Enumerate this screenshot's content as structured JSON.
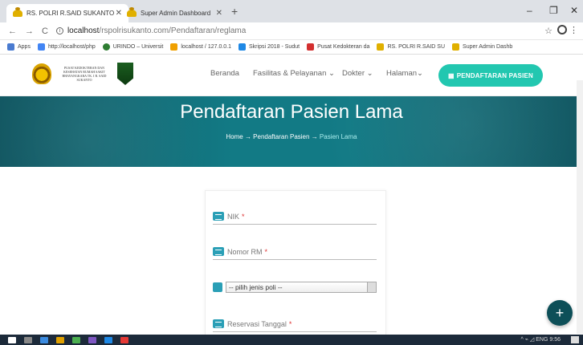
{
  "browser": {
    "tabs": [
      {
        "title": "RS. POLRI R.SAID SUKANTO",
        "close": "✕"
      },
      {
        "title": "Super Admin Dashboard",
        "close": "✕"
      }
    ],
    "new_tab": "+",
    "window_controls": [
      "–",
      "❐",
      "✕"
    ],
    "nav": {
      "back": "←",
      "forward": "→",
      "reload": "C"
    },
    "url_host": "localhost",
    "url_path": "/rspolrisukanto.com/Pendaftaran/reglama",
    "bookmarks": [
      {
        "label": "Apps",
        "color": "#4a7bd0"
      },
      {
        "label": "http://localhost/php",
        "color": "#4285f4"
      },
      {
        "label": "URINDO – Universit",
        "color": "#2e7d32"
      },
      {
        "label": "localhost / 127.0.0.1",
        "color": "#f0a000"
      },
      {
        "label": "Skripsi 2018 - Sudut",
        "color": "#1e88e5"
      },
      {
        "label": "Pusat Kedokteran da",
        "color": "#d32f2f"
      },
      {
        "label": "RS. POLRI R.SAID SU",
        "color": "#e0b000"
      },
      {
        "label": "Super Admin Dashb",
        "color": "#e0b000"
      }
    ]
  },
  "site": {
    "logo_text": "PUSAT KEDOKTERAN DAN KESEHATAN RUMAH SAKIT BHAYANGKARA TK. I R. SAID SUKANTO",
    "menu": [
      "Beranda",
      "Fasilitas & Pelayanan ⌄",
      "Dokter ⌄",
      "Halaman⌄"
    ],
    "cta": "PENDAFTARAN PASIEN",
    "hero_title": "Pendaftaran Pasien Lama",
    "breadcrumb": {
      "home": "Home",
      "sep": "→",
      "mid": "Pendaftaran Pasien",
      "current": "Pasien Lama"
    }
  },
  "form": {
    "nik": "NIK",
    "nomor_rm": "Nomor RM",
    "poli_placeholder": "-- pilih jenis poli --",
    "reservasi": "Reservasi Tanggal",
    "required_mark": "*"
  },
  "fab": "+",
  "taskbar": {
    "tray": "^ ⌁ ◿ ENG 9:56"
  }
}
